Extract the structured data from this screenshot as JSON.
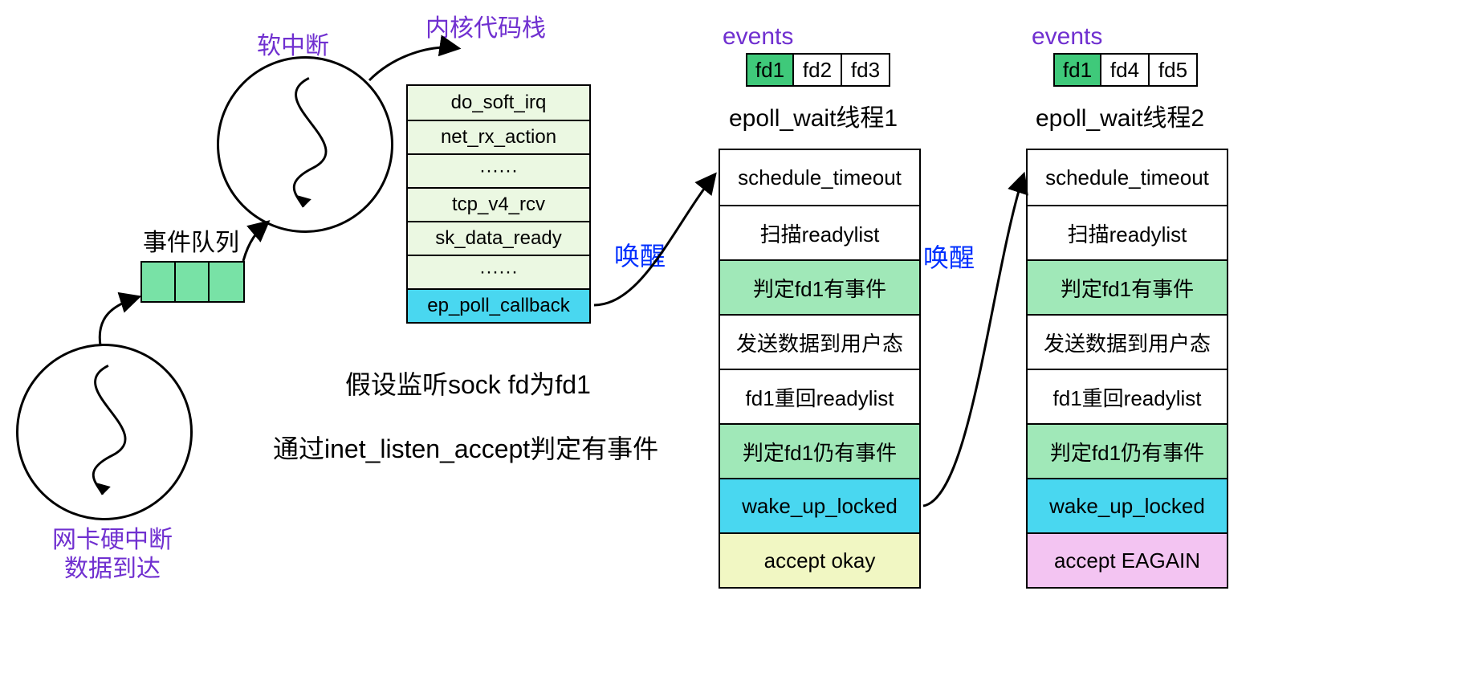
{
  "labels": {
    "soft_irq": "软中断",
    "kernel_stack_title": "内核代码栈",
    "event_queue": "事件队列",
    "hard_irq_line1": "网卡硬中断",
    "hard_irq_line2": "数据到达",
    "wake1": "唤醒",
    "wake2": "唤醒",
    "events1": "events",
    "events2": "events",
    "thread1_title": "epoll_wait线程1",
    "thread2_title": "epoll_wait线程2",
    "assumption_line1": "假设监听sock fd为fd1",
    "assumption_line2": "通过inet_listen_accept判定有事件"
  },
  "fd_row1": [
    "fd1",
    "fd2",
    "fd3"
  ],
  "fd_row2": [
    "fd1",
    "fd4",
    "fd5"
  ],
  "kernel_stack": [
    "do_soft_irq",
    "net_rx_action",
    "······",
    "tcp_v4_rcv",
    "sk_data_ready",
    "······",
    "ep_poll_callback"
  ],
  "thread1_stack": [
    {
      "t": "schedule_timeout",
      "c": "bg-white"
    },
    {
      "t": "扫描readylist",
      "c": "bg-white"
    },
    {
      "t": "判定fd1有事件",
      "c": "bg-green"
    },
    {
      "t": "发送数据到用户态",
      "c": "bg-white"
    },
    {
      "t": "fd1重回readylist",
      "c": "bg-white"
    },
    {
      "t": "判定fd1仍有事件",
      "c": "bg-green"
    },
    {
      "t": "wake_up_locked",
      "c": "bg-cyan"
    },
    {
      "t": "accept okay",
      "c": "bg-yellow"
    }
  ],
  "thread2_stack": [
    {
      "t": "schedule_timeout",
      "c": "bg-white"
    },
    {
      "t": "扫描readylist",
      "c": "bg-white"
    },
    {
      "t": "判定fd1有事件",
      "c": "bg-green"
    },
    {
      "t": "发送数据到用户态",
      "c": "bg-white"
    },
    {
      "t": "fd1重回readylist",
      "c": "bg-white"
    },
    {
      "t": "判定fd1仍有事件",
      "c": "bg-green"
    },
    {
      "t": "wake_up_locked",
      "c": "bg-cyan"
    },
    {
      "t": "accept EAGAIN",
      "c": "bg-pink"
    }
  ]
}
